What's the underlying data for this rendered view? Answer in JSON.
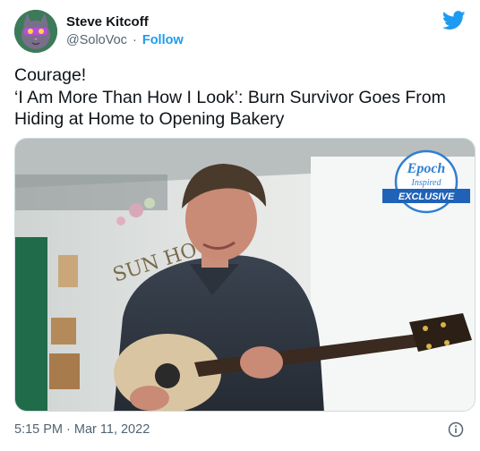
{
  "author": {
    "display_name": "Steve Kitcoff",
    "handle": "@SoloVoc",
    "separator": "·",
    "follow_label": "Follow"
  },
  "tweet": {
    "text": "Courage!\n‘I Am More Than How I Look’: Burn Survivor Goes From Hiding at Home to Opening Bakery",
    "timestamp": "5:15 PM · Mar 11, 2022"
  },
  "image": {
    "badge_line1": "Epoch",
    "badge_line2": "Inspired",
    "badge_line3": "EXCLUSIVE",
    "wall_sign": "SUN HOUS"
  },
  "colors": {
    "accent": "#1d9bf0",
    "text": "#0f1419",
    "muted": "#536471"
  },
  "icons": {
    "brand": "twitter-bird-icon",
    "info": "info-icon"
  }
}
